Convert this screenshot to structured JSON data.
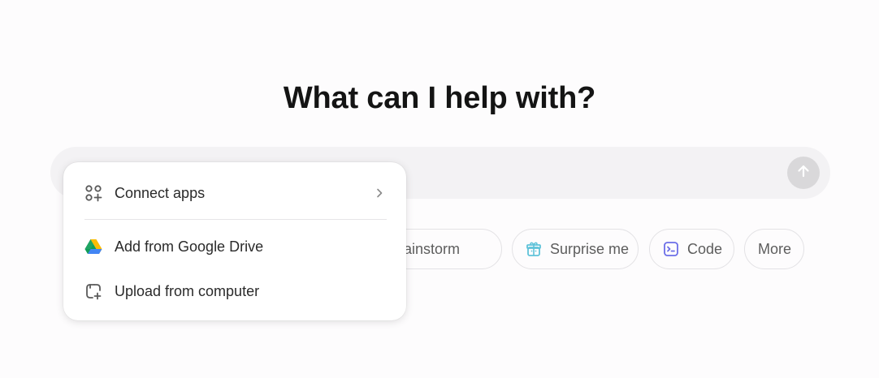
{
  "headline": "What can I help with?",
  "composer": {
    "placeholder": "",
    "send_icon": "arrow-up-icon"
  },
  "suggestions": [
    {
      "label": "Brainstorm",
      "icon": "lightbulb-icon",
      "icon_color": "#e2b33c"
    },
    {
      "label": "Surprise me",
      "icon": "gift-icon",
      "icon_color": "#5ec2d9"
    },
    {
      "label": "Code",
      "icon": "terminal-icon",
      "icon_color": "#6b6ee8"
    },
    {
      "label": "More",
      "icon": ""
    }
  ],
  "attach_menu": {
    "items": [
      {
        "label": "Connect apps",
        "icon": "apps-grid-plus-icon",
        "has_submenu": true
      },
      {
        "label": "Add from Google Drive",
        "icon": "google-drive-icon",
        "has_submenu": false
      },
      {
        "label": "Upload from computer",
        "icon": "upload-file-icon",
        "has_submenu": false
      }
    ]
  },
  "colors": {
    "background": "#fdfcfd",
    "composer_bg": "#f3f2f4",
    "send_button_disabled": "#d9d8da",
    "chip_border": "#e3e2e5"
  }
}
